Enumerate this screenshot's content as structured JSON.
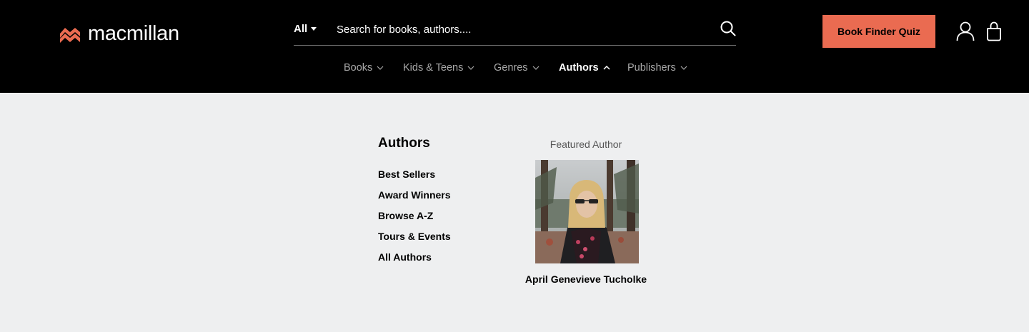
{
  "brand": {
    "name": "macmillan",
    "logo_color": "#ea6b51"
  },
  "search": {
    "scope": "All",
    "placeholder": "Search for books, authors...."
  },
  "cta": {
    "label": "Book Finder Quiz",
    "color": "#ea6b51"
  },
  "icons": {
    "search": "search-icon",
    "account": "user-icon",
    "cart": "shopping-bag-icon"
  },
  "nav": {
    "items": [
      {
        "label": "Books",
        "expanded": false
      },
      {
        "label": "Kids & Teens",
        "expanded": false
      },
      {
        "label": "Genres",
        "expanded": false
      },
      {
        "label": "Authors",
        "expanded": true
      },
      {
        "label": "Publishers",
        "expanded": false
      }
    ]
  },
  "menu": {
    "title": "Authors",
    "links": [
      "Best Sellers",
      "Award Winners",
      "Browse A-Z",
      "Tours & Events",
      "All Authors"
    ],
    "featured": {
      "label": "Featured Author",
      "name": "April Genevieve Tucholke"
    }
  }
}
